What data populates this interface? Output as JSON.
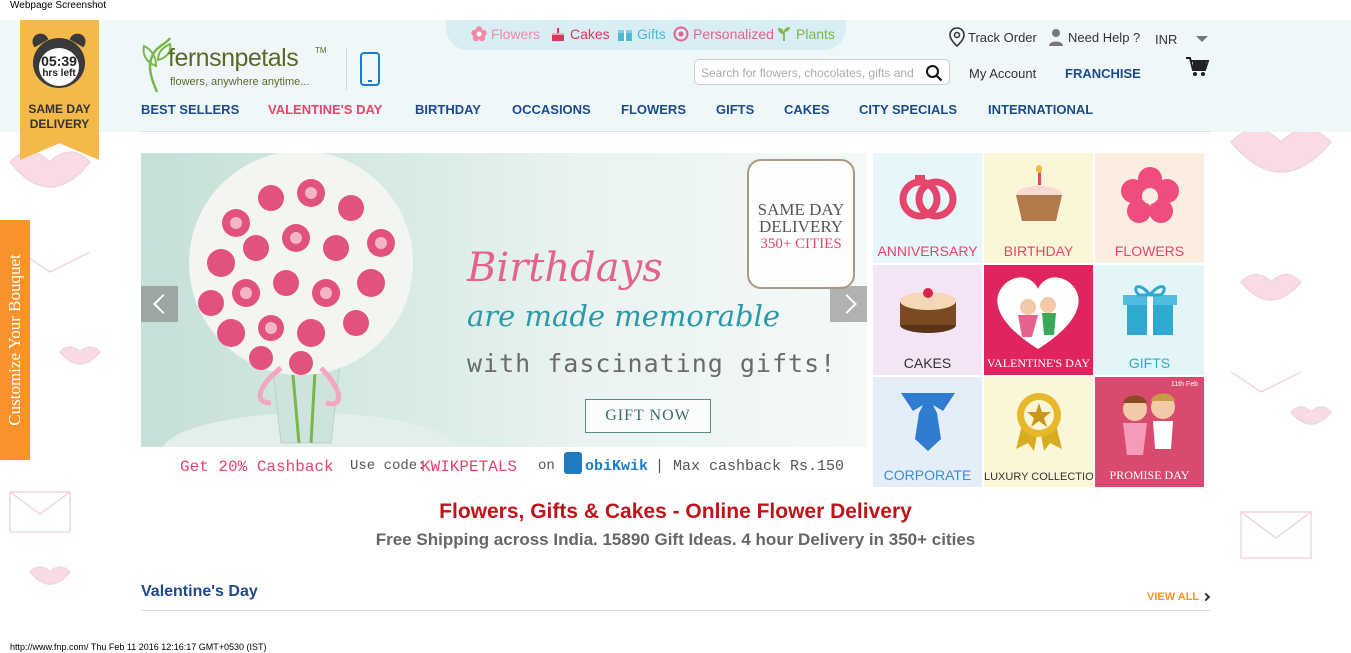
{
  "captions": {
    "top": "Webpage Screenshot",
    "bottom": "http://www.fnp.com/ Thu Feb 11 2016 12:16:17 GMT+0530 (IST)"
  },
  "countdown": {
    "time": "05:39",
    "sub": "hrs left",
    "line1": "SAME DAY",
    "line2": "DELIVERY"
  },
  "logo": {
    "name": "fernsnpetals",
    "tm": "TM",
    "tagline": "flowers, anywhere anytime..."
  },
  "categories": [
    {
      "label": "Flowers",
      "icon": "flower-icon",
      "color": "#f08aa8"
    },
    {
      "label": "Cakes",
      "icon": "cake-icon",
      "color": "#d9365a"
    },
    {
      "label": "Gifts",
      "icon": "gift-icon",
      "color": "#4eb8d8"
    },
    {
      "label": "Personalized",
      "icon": "personalized-icon",
      "color": "#e5628e"
    },
    {
      "label": "Plants",
      "icon": "plant-icon",
      "color": "#7ab648"
    }
  ],
  "utility": {
    "track_order": "Track Order",
    "need_help": "Need Help ?",
    "currency": "INR",
    "my_account": "My Account",
    "franchise": "FRANCHISE"
  },
  "search": {
    "placeholder": "Search for flowers, chocolates, gifts and more",
    "value": ""
  },
  "nav": [
    {
      "label": "BEST SELLERS",
      "highlight": false
    },
    {
      "label": "VALENTINE'S DAY",
      "highlight": true
    },
    {
      "label": "BIRTHDAY",
      "highlight": false
    },
    {
      "label": "OCCASIONS",
      "highlight": false
    },
    {
      "label": "FLOWERS",
      "highlight": false
    },
    {
      "label": "GIFTS",
      "highlight": false
    },
    {
      "label": "CAKES",
      "highlight": false
    },
    {
      "label": "CITY SPECIALS",
      "highlight": false
    },
    {
      "label": "INTERNATIONAL",
      "highlight": false
    }
  ],
  "customize_tab": "Customize Your Bouquet",
  "banner": {
    "stamp_line1": "SAME DAY",
    "stamp_line2": "DELIVERY",
    "stamp_line3": "350+ CITIES",
    "title_line1": "Birthdays",
    "title_line2": "are made memorable",
    "title_line3": "with fascinating gifts!",
    "cta": "GIFT NOW",
    "promo_cashback": "Get 20% Cashback",
    "promo_use": "Use code:",
    "promo_code": "KWIKPETALS",
    "promo_on": "on",
    "promo_brand": "obiKwik",
    "promo_max": "| Max cashback Rs.150"
  },
  "tiles": [
    {
      "label": "ANNIVERSARY",
      "bg": "#e6f6fa",
      "color": "#e5456a",
      "icon": "rings-icon"
    },
    {
      "label": "BIRTHDAY",
      "bg": "#fbf6d8",
      "color": "#e5456a",
      "icon": "cupcake-icon"
    },
    {
      "label": "FLOWERS",
      "bg": "#fbeee0",
      "color": "#e5456a",
      "icon": "flower-icon"
    },
    {
      "label": "CAKES",
      "bg": "#f3e4f6",
      "color": "#333333",
      "icon": "cake-icon"
    },
    {
      "label": "VALENTINE'S DAY",
      "bg": "#e0255e",
      "color": "#ffffff",
      "icon": "heart-couple-icon"
    },
    {
      "label": "GIFTS",
      "bg": "#e3f5f7",
      "color": "#2eaad0",
      "icon": "gift-icon"
    },
    {
      "label": "CORPORATE",
      "bg": "#e3eef8",
      "color": "#3a8fd0",
      "icon": "tie-icon"
    },
    {
      "label": "LUXURY COLLECTION",
      "bg": "#fbf6d8",
      "color": "#333333",
      "icon": "badge-icon"
    },
    {
      "label": "PROMISE DAY",
      "bg": "#d94a6f",
      "color": "#ffffff",
      "icon": "couple-icon",
      "date": "11th Feb"
    }
  ],
  "main_title": "Flowers, Gifts & Cakes - Online Flower Delivery",
  "sub_title": "Free Shipping across India. 15890 Gift Ideas. 4 hour Delivery in 350+ cities",
  "valentine": {
    "title": "Valentine's Day",
    "view_all": "VIEW ALL"
  }
}
